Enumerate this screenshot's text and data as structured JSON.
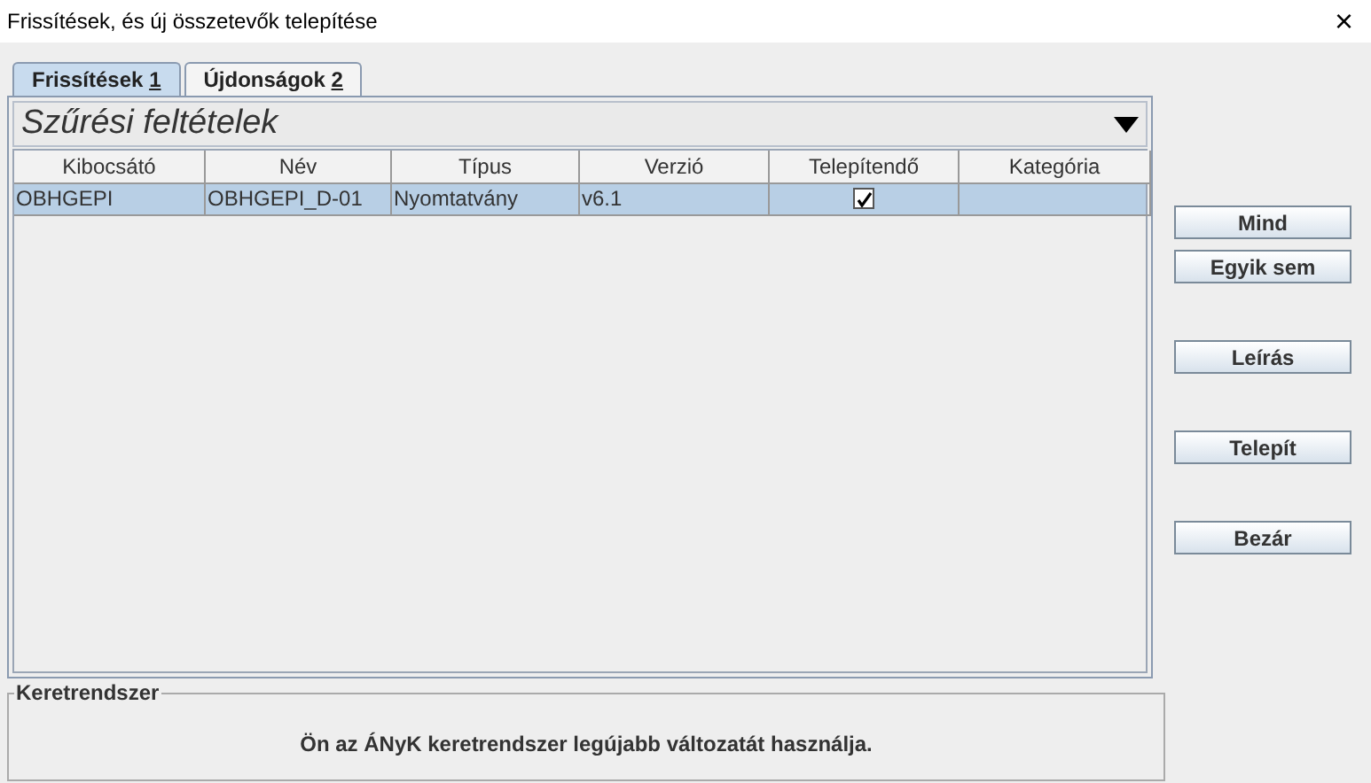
{
  "window": {
    "title": "Frissítések, és új összetevők telepítése",
    "close": "×"
  },
  "tabs": [
    {
      "label": "Frissítések",
      "shortcut": "1",
      "selected": true
    },
    {
      "label": "Újdonságok",
      "shortcut": "2",
      "selected": false
    }
  ],
  "filter": {
    "title": "Szűrési feltételek",
    "expanded": false
  },
  "table": {
    "columns": [
      "Kibocsátó",
      "Név",
      "Típus",
      "Verzió",
      "Telepítendő",
      "Kategória"
    ],
    "rows": [
      {
        "issuer": "OBHGEPI",
        "name": "OBHGEPI_D-01",
        "type": "Nyomtatvány",
        "version": "v6.1",
        "install": true,
        "selected": true
      }
    ]
  },
  "buttons": [
    "Mind",
    "Egyik sem",
    "Leírás",
    "Telepít",
    "Bezár"
  ],
  "framework": {
    "title": "Keretrendszer",
    "message": "Ön az ÁNyK keretrendszer legújabb változatát használja."
  }
}
